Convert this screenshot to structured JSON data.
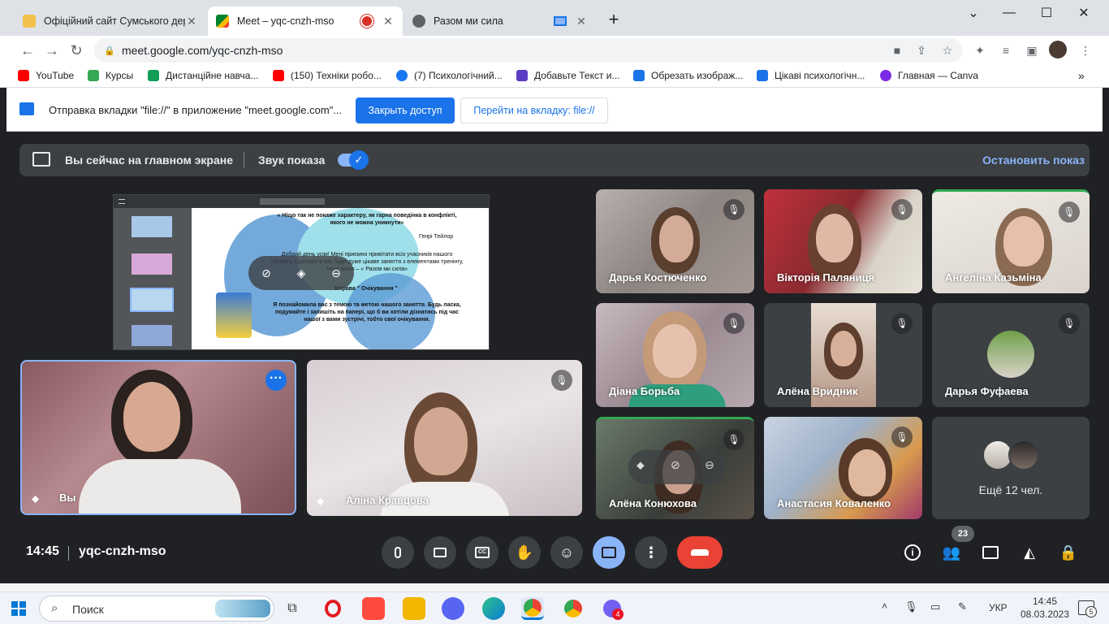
{
  "browser": {
    "tabs": [
      {
        "title": "Офіційний сайт Сумського дер"
      },
      {
        "title": "Meet – yqc-cnzh-mso"
      },
      {
        "title": "Разом ми сила"
      }
    ],
    "url": "meet.google.com/yqc-cnzh-mso",
    "bookmarks": [
      {
        "label": "YouTube",
        "color": "#ff0000"
      },
      {
        "label": "Курсы",
        "color": "#34a853"
      },
      {
        "label": "Дистанційне навча...",
        "color": "#0f9d58"
      },
      {
        "label": "(150) Техніки робо...",
        "color": "#ff0000"
      },
      {
        "label": "(7) Психологічний...",
        "color": "#1877f2"
      },
      {
        "label": "Добавьте Текст и...",
        "color": "#5b3cc4"
      },
      {
        "label": "Обрезать изображ...",
        "color": "#1a73e8"
      },
      {
        "label": "Цікаві психологічн...",
        "color": "#1a73e8"
      },
      {
        "label": "Главная — Canva",
        "color": "#7d2ae8"
      }
    ]
  },
  "infobar": {
    "message": "Отправка вкладки \"file://\" в приложение \"meet.google.com\"...",
    "stop_label": "Закрыть доступ",
    "goto_label": "Перейти на вкладку: file://"
  },
  "sharebar": {
    "status": "Вы сейчас на главном экране",
    "audio_label": "Звук показа",
    "stop_label": "Остановить показ"
  },
  "presentation": {
    "quote": "« Ніщо так не покаже характеру, як гарна поведінка в конфлікті, якого не можна уникнути»",
    "author": "Генрі Тейлор",
    "greeting": "Добрий день усім! Мені приємно привітати всіх учасників нашого тренінгу. Сьогодні в нас буде дуже цікаве заняття з елементами тренінгу, тема якого – « Разом ми сила»",
    "exercise": "Вправа \" Очікування \"",
    "body": "Я познайомила вас з темою та метою нашого заняття. Будь ласка, подумайте і запишіть на папері, що б ви хотіли дізнатись під час нашої з вами зустрічі, тобто свої очікування."
  },
  "self_tile": {
    "name": "Вы"
  },
  "main_tile": {
    "name": "Аліна Кравцова"
  },
  "participants": [
    {
      "name": "Дарья Костюченко"
    },
    {
      "name": "Вікторія Паляниця"
    },
    {
      "name": "Ангеліна Казьміна"
    },
    {
      "name": "Діана Борьба"
    },
    {
      "name": "Алёна Вридник"
    },
    {
      "name": "Дарья Фуфаева"
    },
    {
      "name": "Алёна Конюхова"
    },
    {
      "name": "Анастасия Коваленко"
    }
  ],
  "more_tile": {
    "label": "Ещё 12 чел."
  },
  "meeting": {
    "time": "14:45",
    "code": "yqc-cnzh-mso",
    "participant_count": "23"
  },
  "taskbar": {
    "search": "Поиск",
    "lang": "УКР",
    "time": "14:45",
    "date": "08.03.2023",
    "notif_count": "5",
    "viber_badge": "4"
  }
}
